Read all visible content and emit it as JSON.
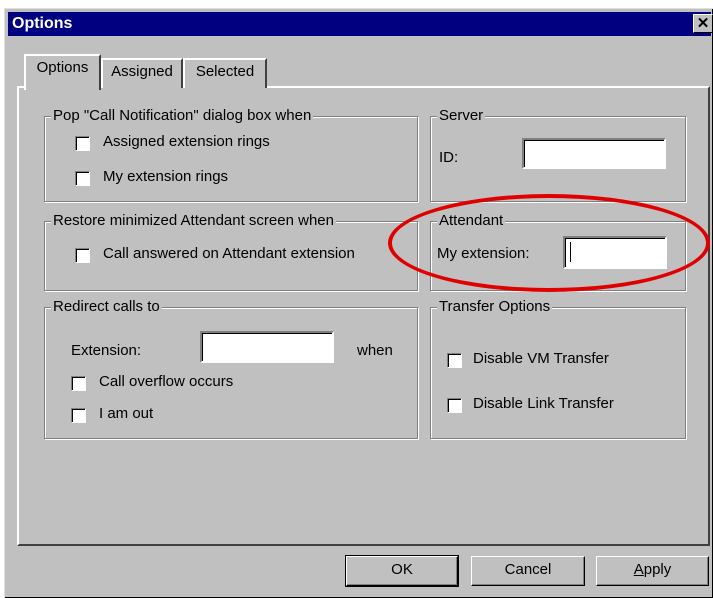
{
  "window": {
    "title": "Options",
    "close_symbol": "✕"
  },
  "tabs": [
    {
      "label": "Options",
      "active": true
    },
    {
      "label": "Assigned",
      "active": false
    },
    {
      "label": "Selected",
      "active": false
    }
  ],
  "call_notification": {
    "legend": "Pop \"Call Notification\" dialog box when",
    "options": [
      {
        "label": "Assigned extension rings",
        "checked": false
      },
      {
        "label": "My extension rings",
        "checked": false
      }
    ]
  },
  "server": {
    "legend": "Server",
    "id_label": "ID:",
    "id_value": ""
  },
  "restore": {
    "legend": "Restore minimized Attendant screen when",
    "options": [
      {
        "label": "Call answered on Attendant extension",
        "checked": false
      }
    ]
  },
  "attendant": {
    "legend": "Attendant",
    "extension_label": "My extension:",
    "extension_value": ""
  },
  "redirect": {
    "legend": "Redirect calls to",
    "extension_label": "Extension:",
    "extension_value": "",
    "when_label": "when",
    "options": [
      {
        "label": "Call overflow occurs",
        "checked": false
      },
      {
        "label": "I am out",
        "checked": false
      }
    ]
  },
  "transfer": {
    "legend": "Transfer Options",
    "options": [
      {
        "label": "Disable VM Transfer",
        "checked": false
      },
      {
        "label": "Disable Link Transfer",
        "checked": false
      }
    ]
  },
  "buttons": {
    "ok": "OK",
    "cancel": "Cancel",
    "apply_first": "A",
    "apply_rest": "pply"
  },
  "annotation": {
    "color": "#e00000"
  }
}
